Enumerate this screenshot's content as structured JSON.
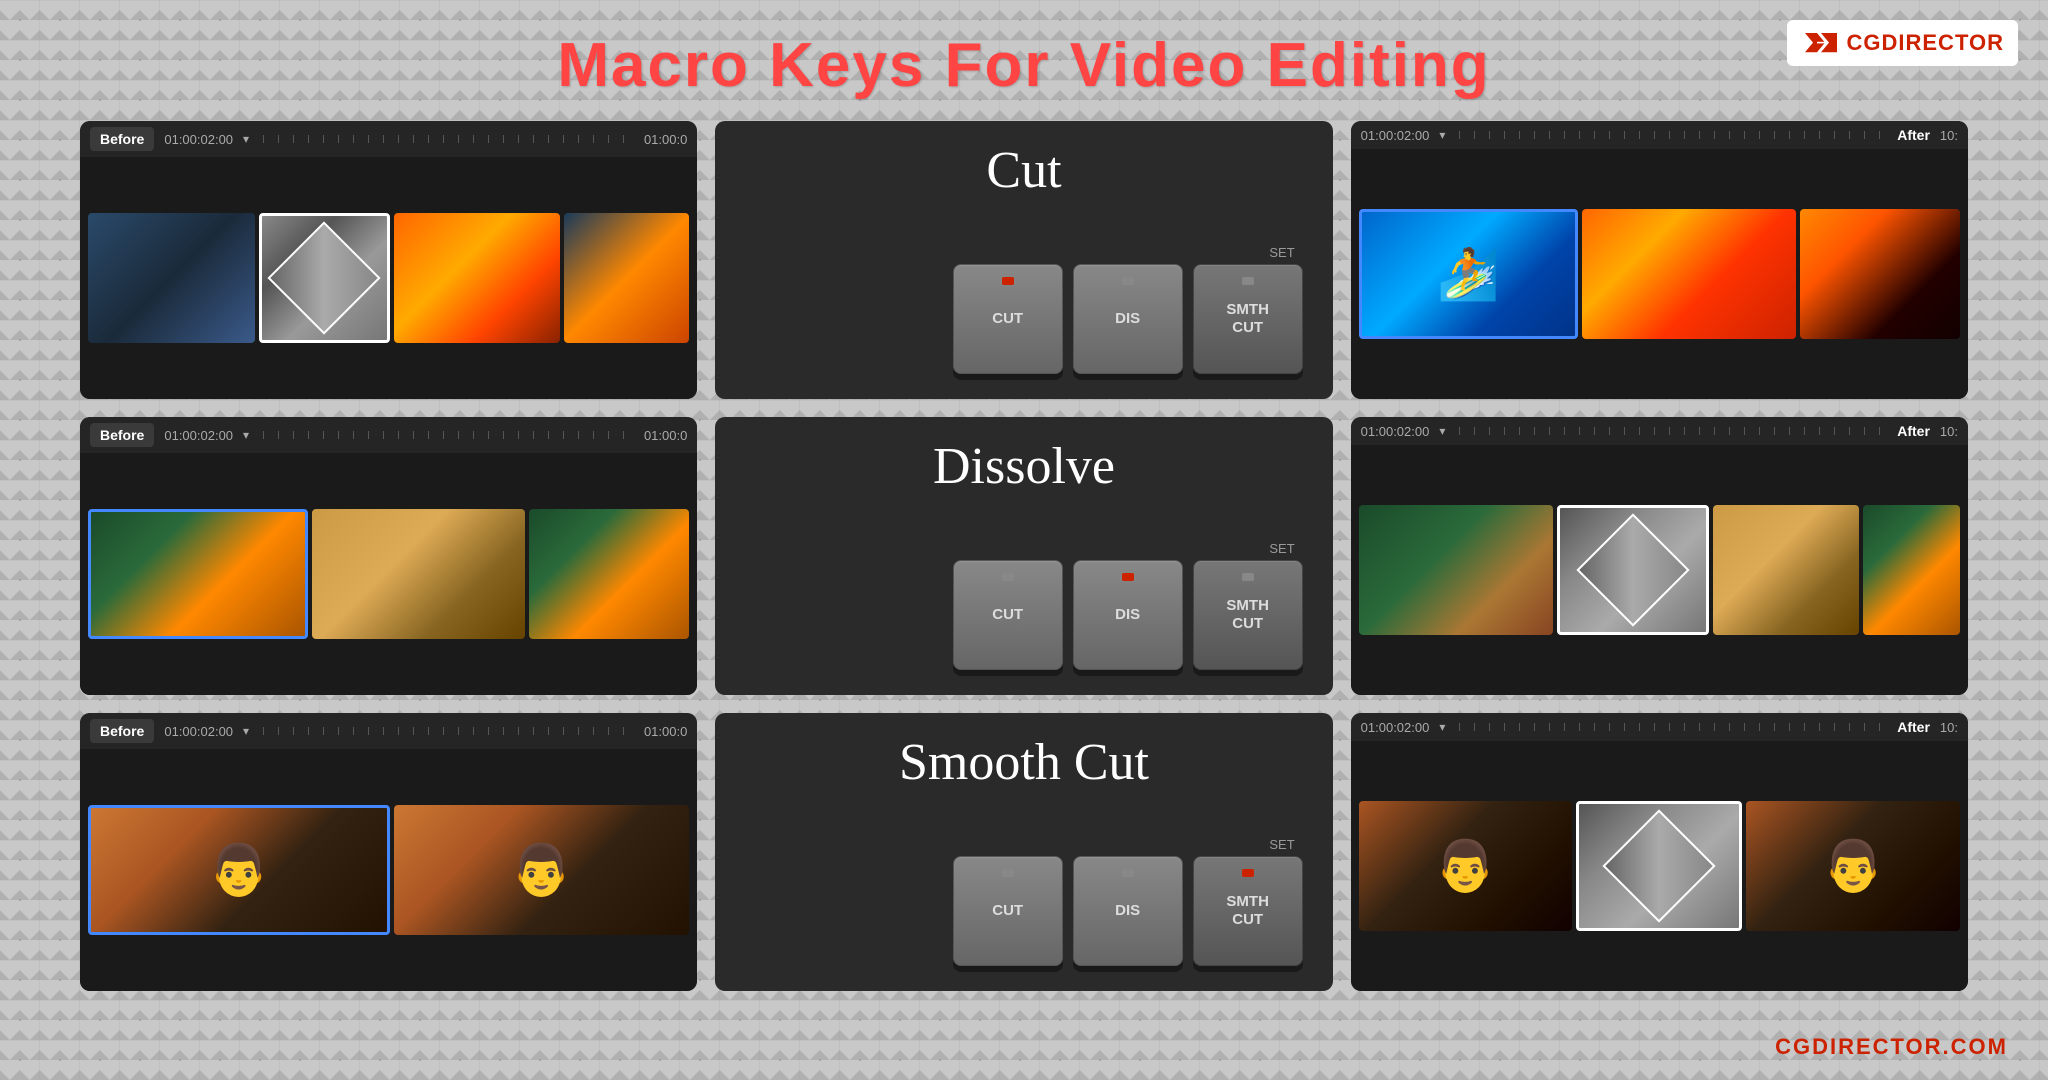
{
  "title": "Macro Keys For Video Editing",
  "logo": {
    "text": "CGDIRECTOR",
    "icon": "⬡"
  },
  "footer": {
    "text": "CGDIRECTOR.COM"
  },
  "rows": [
    {
      "id": "cut",
      "label": "Cut",
      "keys": [
        {
          "id": "cut-key",
          "text": "CUT",
          "indicator": "red",
          "style": "gray"
        },
        {
          "id": "dis-key",
          "text": "DIS",
          "indicator": "gray",
          "style": "gray"
        },
        {
          "id": "smthcut-key",
          "text": "SMTH\nCUT",
          "indicator": "gray",
          "style": "darker"
        }
      ]
    },
    {
      "id": "dissolve",
      "label": "Dissolve",
      "keys": [
        {
          "id": "cut-key",
          "text": "CUT",
          "indicator": "gray",
          "style": "gray"
        },
        {
          "id": "dis-key",
          "text": "DIS",
          "indicator": "red",
          "style": "gray"
        },
        {
          "id": "smthcut-key",
          "text": "SMTH\nCUT",
          "indicator": "gray",
          "style": "darker"
        }
      ]
    },
    {
      "id": "smooth-cut",
      "label": "Smooth Cut",
      "keys": [
        {
          "id": "cut-key",
          "text": "CUT",
          "indicator": "gray",
          "style": "gray"
        },
        {
          "id": "dis-key",
          "text": "DIS",
          "indicator": "gray",
          "style": "gray"
        },
        {
          "id": "smthcut-key",
          "text": "SMTH\nCUT",
          "indicator": "red",
          "style": "darker"
        }
      ]
    }
  ],
  "set_label": "SET",
  "before_label": "Before",
  "after_label": "After",
  "timecode": "01:00:02:00"
}
